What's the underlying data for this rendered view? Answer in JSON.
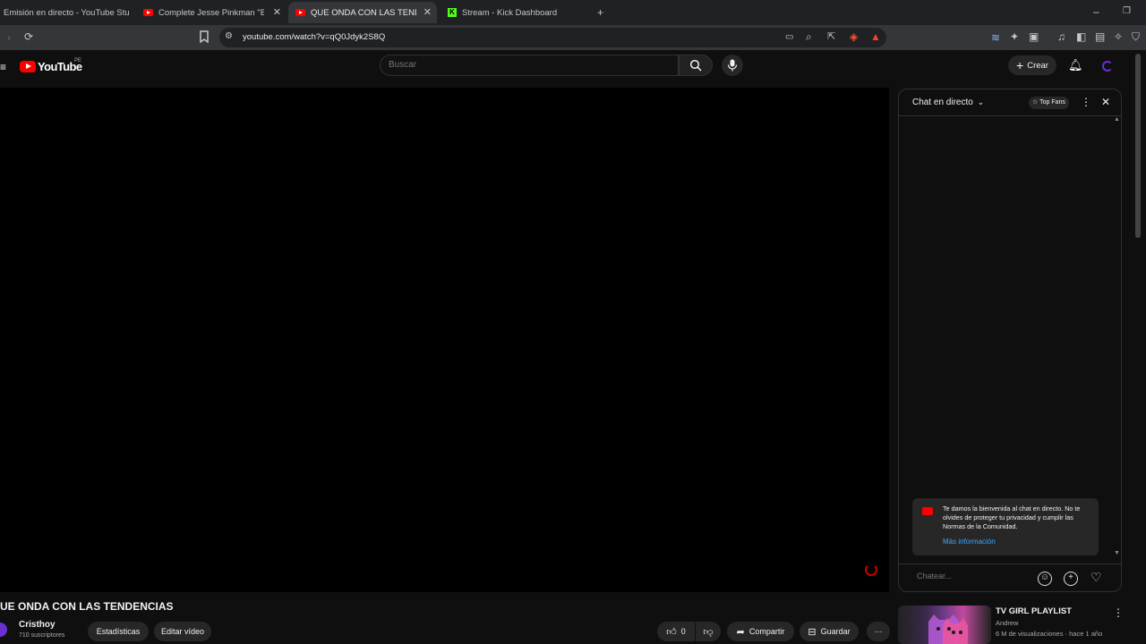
{
  "browser": {
    "tabs": [
      {
        "label": "Emisión en directo - YouTube Studio"
      },
      {
        "label": "Complete Jesse Pinkman \"BITCH"
      },
      {
        "label": "QUE ONDA CON LAS TENDENCI"
      },
      {
        "label": "Stream - Kick Dashboard"
      }
    ],
    "url": "youtube.com/watch?v=qQ0Jdyk2S8Q"
  },
  "header": {
    "logo_text": "YouTube",
    "country": "PE",
    "search_placeholder": "Buscar",
    "create_label": "Crear"
  },
  "chat": {
    "title": "Chat en directo",
    "top_fans": "Top Fans",
    "welcome_text": "Te damos la bienvenida al chat en directo. No te olvides de proteger tu privacidad y cumplir las Normas de la Comunidad.",
    "more_info": "Más información",
    "input_placeholder": "Chatear..."
  },
  "video": {
    "title": "UE ONDA CON LAS TENDENCIAS",
    "channel": "Cristhoy",
    "subscribers": "710 suscriptores",
    "stats_label": "Estadísticas",
    "edit_label": "Editar vídeo",
    "likes": "0",
    "share_label": "Compartir",
    "save_label": "Guardar"
  },
  "recommendation": {
    "title": "TV GIRL PLAYLIST",
    "author": "Andrew",
    "meta": "6 M de visualizaciones · hace 1 año"
  }
}
